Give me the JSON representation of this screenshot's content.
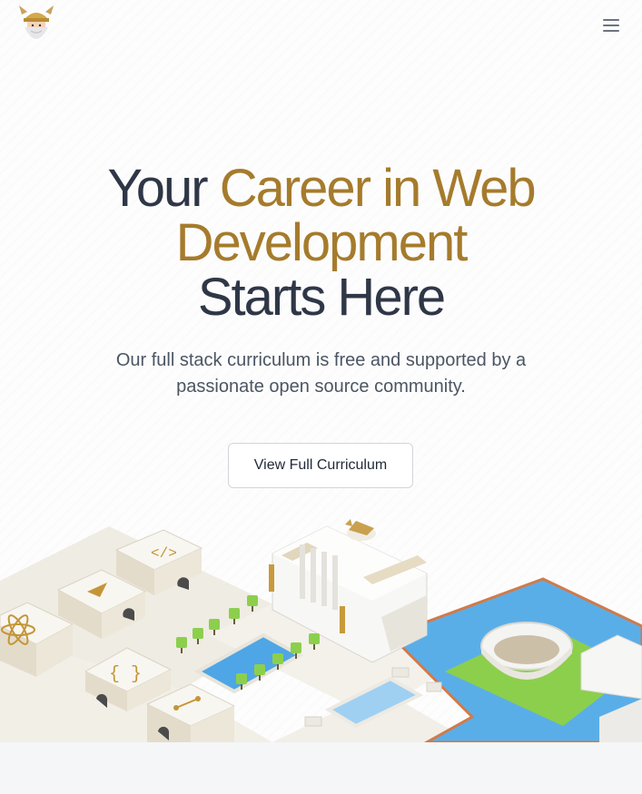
{
  "header": {
    "logo_icon": "viking-mascot-icon",
    "menu_icon": "hamburger-menu-icon"
  },
  "hero": {
    "title_part1": "Your ",
    "title_accent_line1": "Career in Web",
    "title_accent_line2": "Development",
    "title_line3": "Starts Here",
    "subtitle": "Our full stack curriculum is free and supported by a passionate open source community.",
    "cta_label": "View Full Curriculum"
  },
  "colors": {
    "accent": "#a57b2c",
    "heading": "#2f3747",
    "text": "#4b5563",
    "water": "#5aaee8",
    "grass": "#8ccf4d",
    "path": "#e8e4da",
    "border": "#d1d5db"
  },
  "illustration": {
    "icon_names": [
      "atom-icon",
      "play-triangle-icon",
      "code-brackets-icon",
      "curly-braces-icon",
      "git-branch-icon",
      "viking-mascot-icon"
    ]
  }
}
